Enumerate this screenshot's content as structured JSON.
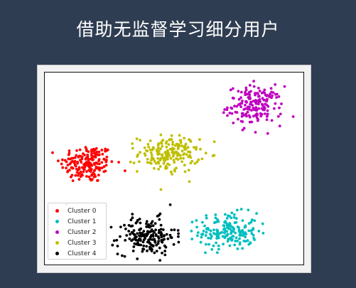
{
  "slide": {
    "title": "借助无监督学习细分用户"
  },
  "chart_data": {
    "type": "scatter",
    "title": "",
    "xlabel": "",
    "ylabel": "",
    "grid": false,
    "axes_ticks_visible": false,
    "xlim": [
      -12,
      12
    ],
    "ylim": [
      -10,
      10
    ],
    "legend": {
      "position": "bottom-left"
    },
    "series": [
      {
        "name": "Cluster 0",
        "color": "#ff0000",
        "center": [
          -8.0,
          0.5
        ],
        "spread": [
          1.25,
          1.0
        ],
        "count": 180
      },
      {
        "name": "Cluster 1",
        "color": "#00bfbf",
        "center": [
          5.0,
          -6.5
        ],
        "spread": [
          1.35,
          0.95
        ],
        "count": 180
      },
      {
        "name": "Cluster 2",
        "color": "#bf00bf",
        "center": [
          7.5,
          6.5
        ],
        "spread": [
          1.25,
          1.0
        ],
        "count": 180
      },
      {
        "name": "Cluster 3",
        "color": "#bfbf00",
        "center": [
          -0.5,
          1.5
        ],
        "spread": [
          1.4,
          0.95
        ],
        "count": 180
      },
      {
        "name": "Cluster 4",
        "color": "#000000",
        "center": [
          -2.5,
          -7.0
        ],
        "spread": [
          1.3,
          0.95
        ],
        "count": 180
      }
    ]
  }
}
